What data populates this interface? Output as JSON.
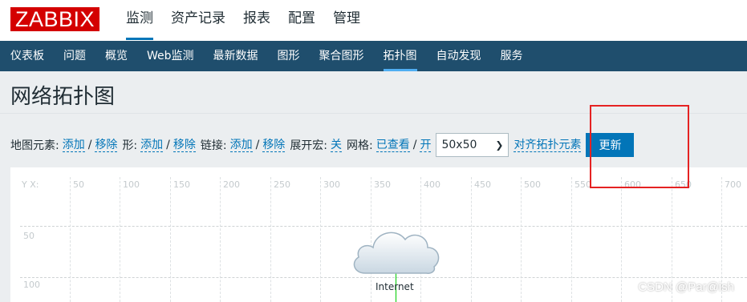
{
  "logo": "ZABBIX",
  "top_nav": [
    {
      "label": "监测",
      "active": true
    },
    {
      "label": "资产记录",
      "active": false
    },
    {
      "label": "报表",
      "active": false
    },
    {
      "label": "配置",
      "active": false
    },
    {
      "label": "管理",
      "active": false
    }
  ],
  "sub_nav": [
    {
      "label": "仪表板",
      "active": false
    },
    {
      "label": "问题",
      "active": false
    },
    {
      "label": "概览",
      "active": false
    },
    {
      "label": "Web监测",
      "active": false
    },
    {
      "label": "最新数据",
      "active": false
    },
    {
      "label": "图形",
      "active": false
    },
    {
      "label": "聚合图形",
      "active": false
    },
    {
      "label": "拓扑图",
      "active": true
    },
    {
      "label": "自动发现",
      "active": false
    },
    {
      "label": "服务",
      "active": false
    }
  ],
  "page_title": "网络拓扑图",
  "toolbar": {
    "map_elements_label": "地图元素:",
    "add": "添加",
    "remove": "移除",
    "shapes_label": "形:",
    "links_label": "链接:",
    "expand_macros_label": "展开宏:",
    "expand_macros_value": "关",
    "grid_label": "网格:",
    "grid_shown": "已查看",
    "grid_on": "开",
    "slash": "/",
    "grid_size": "50x50",
    "align_elements": "对齐拓扑元素",
    "update_button": "更新"
  },
  "map": {
    "axis_label": "Y X:",
    "x_ticks": [
      "50",
      "100",
      "150",
      "200",
      "250",
      "300",
      "350",
      "400",
      "450",
      "500",
      "550",
      "600",
      "650",
      "700"
    ],
    "y_ticks": [
      "50",
      "100"
    ],
    "host_label": "Internet"
  },
  "watermark": "CSDN @Par@ish",
  "colors": {
    "brand_red": "#d40000",
    "subnav_bg": "#1f4e6d",
    "link_blue": "#0275b8",
    "annotation_red": "#e52222",
    "link_line_green": "#00cc00"
  }
}
